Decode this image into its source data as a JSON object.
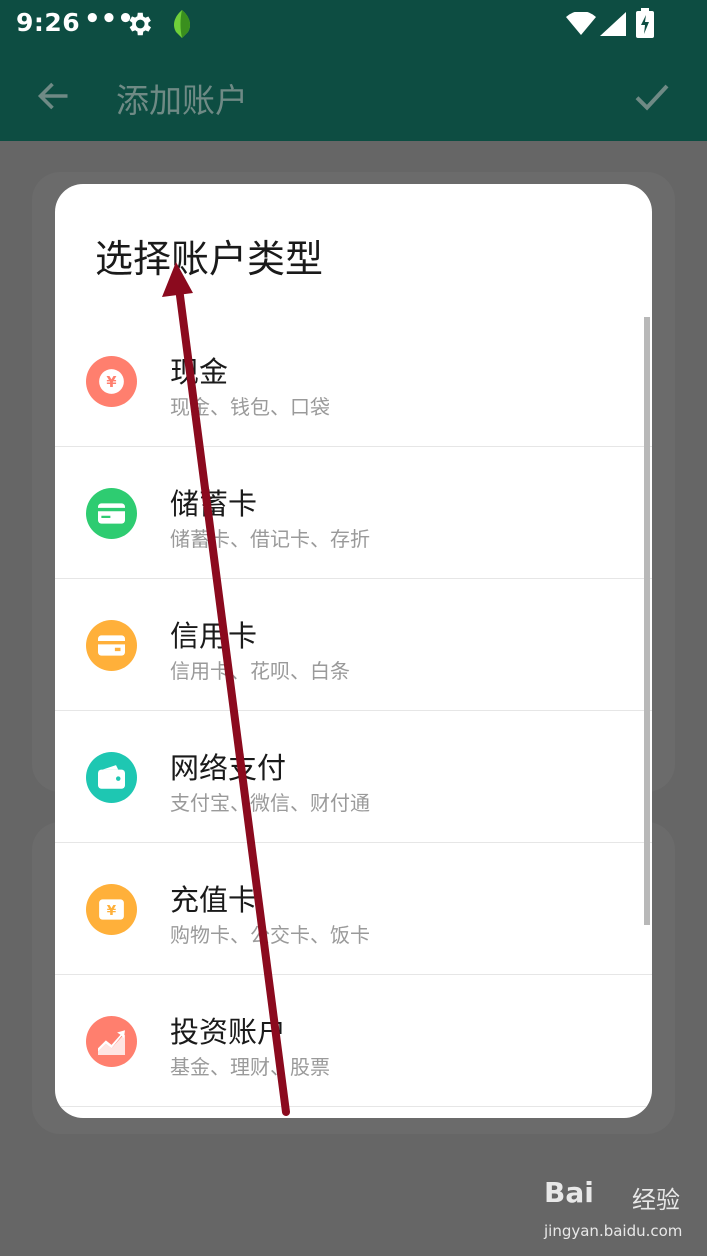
{
  "status_bar": {
    "time": "9:26",
    "overflow": "•••",
    "icons": [
      "gear-icon",
      "leaf-icon",
      "wifi-icon",
      "signal-icon",
      "battery-charging-icon"
    ]
  },
  "app_bar": {
    "title": "添加账户",
    "back_icon": "arrow-back-icon",
    "confirm_icon": "check-icon"
  },
  "dialog": {
    "title": "选择账户类型",
    "items": [
      {
        "name": "现金",
        "sub": "现金、钱包、口袋",
        "icon": "yen-coin-icon",
        "color": "#ff7f6e"
      },
      {
        "name": "储蓄卡",
        "sub": "储蓄卡、借记卡、存折",
        "icon": "card-icon",
        "color": "#2ecc71"
      },
      {
        "name": "信用卡",
        "sub": "信用卡、花呗、白条",
        "icon": "credit-card-icon",
        "color": "#ffb03a"
      },
      {
        "name": "网络支付",
        "sub": "支付宝、微信、财付通",
        "icon": "wallet-icon",
        "color": "#1ec7b2"
      },
      {
        "name": "充值卡",
        "sub": "购物卡、公交卡、饭卡",
        "icon": "yen-ticket-icon",
        "color": "#ffb03a"
      },
      {
        "name": "投资账户",
        "sub": "基金、理财、股票",
        "icon": "trend-up-icon",
        "color": "#ff7f6e"
      }
    ]
  },
  "watermark": {
    "logo": "Bai",
    "brand": "经验",
    "url": "jingyan.baidu.com"
  },
  "colors": {
    "primary_dark": "#0d4d42",
    "scrim": "#666666",
    "annotation_arrow": "#8b0a1e"
  }
}
